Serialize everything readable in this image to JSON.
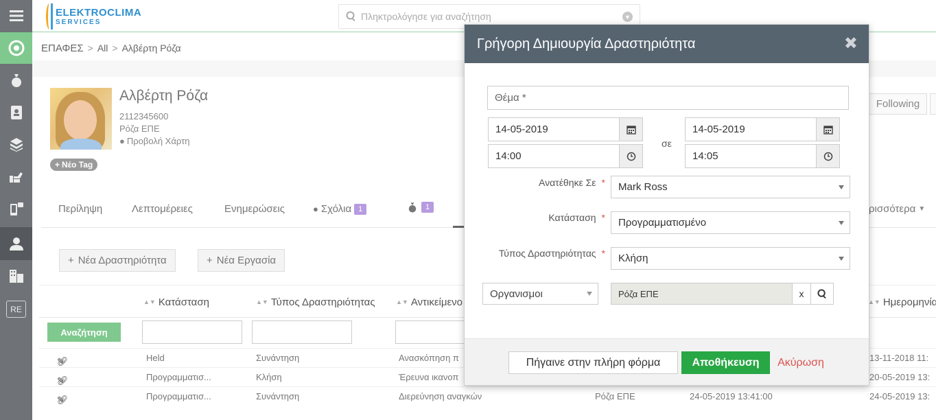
{
  "app": {
    "logo_line1": "ELEKTROCLIMA",
    "logo_line2": "SERVICES",
    "search_placeholder": "Πληκτρολόγησε για αναζήτηση"
  },
  "sidebar": {
    "items": [
      {
        "icon": "menu-icon"
      },
      {
        "icon": "dashboard-icon"
      },
      {
        "icon": "money-bag-icon"
      },
      {
        "icon": "contact-book-icon"
      },
      {
        "icon": "boxes-icon"
      },
      {
        "icon": "handshake-icon"
      },
      {
        "icon": "devices-icon"
      },
      {
        "icon": "user-icon"
      },
      {
        "icon": "building-icon"
      }
    ],
    "re_label": "RE"
  },
  "breadcrumb": {
    "root": "ΕΠΑΦΕΣ",
    "middle": "All",
    "current": "Αλβέρτη Ρόζα"
  },
  "contact": {
    "name": "Αλβέρτη Ρόζα",
    "phone": "2112345600",
    "company": "Ρόζα ΕΠΕ",
    "map_link": "Προβολή Χάρτη",
    "new_tag": "Νέο Tag",
    "following": "Following"
  },
  "tabs": [
    {
      "label": "Περίληψη"
    },
    {
      "label": "Λεπτομέρειες"
    },
    {
      "label": "Ενημερώσεις"
    },
    {
      "label": "Σχόλια",
      "badge": "1"
    },
    {
      "label": "",
      "badge": "1"
    },
    {
      "label": "ρισσότερα"
    }
  ],
  "actions": {
    "new_activity": "Νέα Δραστηριότητα",
    "new_task": "Νέα Εργασία"
  },
  "table": {
    "search_button": "Αναζήτηση",
    "headers": [
      "Κατάσταση",
      "Τύπος Δραστηριότητας",
      "Αντικείμενο",
      "Ημερομηνία"
    ],
    "rows": [
      {
        "status": "Held",
        "type": "Συνάντηση",
        "subject": "Ανασκόπηση π",
        "related": "",
        "start": "",
        "date": "13-11-2018 11:"
      },
      {
        "status": "Προγραμματισ...",
        "type": "Κλήση",
        "subject": "Έρευνα ικανοπ",
        "related": "",
        "start": "",
        "date": "20-05-2019 13:"
      },
      {
        "status": "Προγραμματισ...",
        "type": "Συνάντηση",
        "subject": "Διερεύνηση αναγκών",
        "related": "Ρόζα ΕΠΕ",
        "start": "24-05-2019 13:41:00",
        "date": "24-05-2019 13:"
      }
    ]
  },
  "modal": {
    "title": "Γρήγορη Δημιουργία Δραστηριότητα",
    "subject_placeholder": "Θέμα *",
    "start_date": "14-05-2019",
    "start_time": "14:00",
    "to_label": "σε",
    "end_date": "14-05-2019",
    "end_time": "14:05",
    "assigned_label": "Ανατέθηκε Σε",
    "assigned_value": "Mark Ross",
    "status_label": "Κατάσταση",
    "status_value": "Προγραμματισμένο",
    "type_label": "Τύπος Δραστηριότητας",
    "type_value": "Κλήση",
    "related_module": "Οργανισμοι",
    "related_value": "Ρόζα ΕΠΕ",
    "clear_label": "x",
    "btn_full_form": "Πήγαινε στην πλήρη φόρμα",
    "btn_save": "Αποθήκευση",
    "btn_cancel": "Ακύρωση",
    "required_mark": "*"
  },
  "colors": {
    "green": "#7fc98e",
    "header_dark": "#566470",
    "save": "#28a745",
    "cancel": "#d9534f",
    "badge": "#b79be0"
  }
}
